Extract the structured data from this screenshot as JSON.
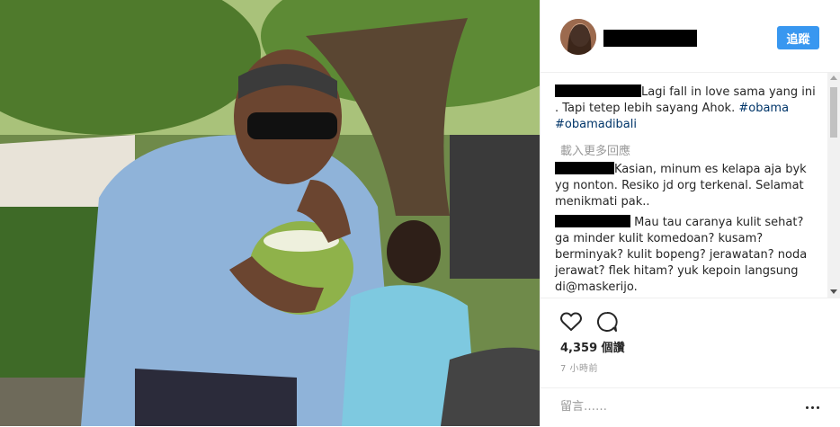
{
  "post": {
    "follow_label": "追蹤",
    "caption_text": "Lagi fall in love sama yang ini . Tapi tetep lebih sayang Ahok. ",
    "hashtags": [
      "#obama",
      "#obamadibali"
    ],
    "load_more_label": "載入更多回應",
    "comments": [
      {
        "text": "Kasian, minum es kelapa aja byk yg nonton. Resiko jd org terkenal. Selamat menikmati pak.."
      },
      {
        "text": "Mau tau caranya kulit sehat? ga minder kulit komedoan? kusam? berminyak? kulit bopeng? jerawatan? noda jerawat? flek hitam? yuk kepoin langsung di@maskerijo."
      }
    ],
    "likes_label": "4,359 個讚",
    "time_label": "7 小時前",
    "comment_placeholder": "留言……",
    "icons": {
      "like": "heart-icon",
      "comment": "comment-bubble-icon",
      "more": "more-options-icon"
    }
  }
}
